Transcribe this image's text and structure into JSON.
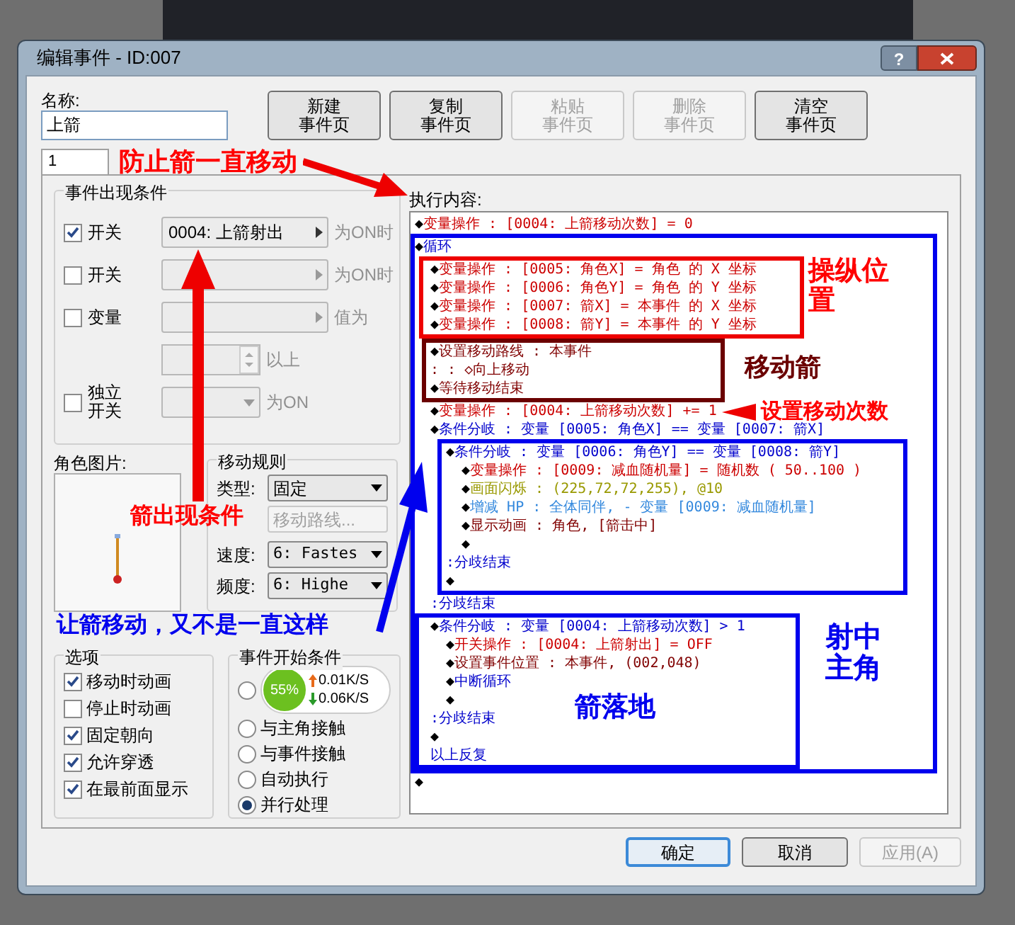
{
  "window": {
    "title": "编辑事件 - ID:007",
    "help_button": "?"
  },
  "name_field": {
    "label": "名称:",
    "value": "上箭"
  },
  "page_buttons": [
    {
      "lines": [
        "新建",
        "事件页"
      ],
      "disabled": false
    },
    {
      "lines": [
        "复制",
        "事件页"
      ],
      "disabled": false
    },
    {
      "lines": [
        "粘贴",
        "事件页"
      ],
      "disabled": true
    },
    {
      "lines": [
        "删除",
        "事件页"
      ],
      "disabled": true
    },
    {
      "lines": [
        "清空",
        "事件页"
      ],
      "disabled": false
    }
  ],
  "tabs": [
    {
      "label": "1",
      "selected": true
    }
  ],
  "conditions": {
    "title": "事件出现条件",
    "rows": [
      {
        "kind": "select",
        "label": "开关",
        "checked": true,
        "value": "0004: 上箭射出",
        "suffix": "为ON时"
      },
      {
        "kind": "select",
        "label": "开关",
        "checked": false,
        "suffix": "为ON时"
      },
      {
        "kind": "select",
        "label": "变量",
        "checked": false,
        "suffix": "值为"
      },
      {
        "kind": "spinner",
        "suffix": "以上"
      },
      {
        "kind": "dropdown",
        "label": "独立开关",
        "checked": false,
        "suffix": "为ON"
      }
    ]
  },
  "graphic": {
    "label": "角色图片:"
  },
  "movement": {
    "title": "移动规则",
    "type_label": "类型:",
    "type_value": "固定",
    "route_button": {
      "label": "移动路线...",
      "disabled": true
    },
    "speed_label": "速度:",
    "speed_value": "6: Fastes",
    "freq_label": "频度:",
    "freq_value": "6: Highe"
  },
  "options": {
    "title": "选项",
    "items": [
      {
        "label": "移动时动画",
        "checked": true
      },
      {
        "label": "停止时动画",
        "checked": false
      },
      {
        "label": "固定朝向",
        "checked": true
      },
      {
        "label": "允许穿透",
        "checked": true
      },
      {
        "label": "在最前面显示",
        "checked": true
      }
    ]
  },
  "trigger": {
    "title": "事件开始条件",
    "items": [
      {
        "selected": false
      },
      {
        "label": "与主角接触",
        "selected": false
      },
      {
        "label": "与事件接触",
        "selected": false
      },
      {
        "label": "自动执行",
        "selected": false
      },
      {
        "label": "并行处理",
        "selected": true
      }
    ]
  },
  "contents": {
    "title": "执行内容:",
    "lines": [
      {
        "bullet": "◆",
        "text": "变量操作 : [0004: 上箭移动次数] = 0",
        "color": "#cc0000"
      },
      {
        "bullet": "◆",
        "text": "循环",
        "color": "#0000cc",
        "children": [
          {
            "bullet": "◆",
            "text": "变量操作 : [0005: 角色X] = 角色 的 X 坐标",
            "color": "#cc0000"
          },
          {
            "bullet": "◆",
            "text": "变量操作 : [0006: 角色Y] = 角色 的 Y 坐标",
            "color": "#cc0000"
          },
          {
            "bullet": "◆",
            "text": "变量操作 : [0007: 箭X] = 本事件 的 X 坐标",
            "color": "#cc0000"
          },
          {
            "bullet": "◆",
            "text": "变量操作 : [0008: 箭Y] = 本事件 的 Y 坐标",
            "color": "#cc0000"
          },
          {
            "bullet": "◆",
            "text": "设置移动路线 : 本事件",
            "color": "#800000"
          },
          {
            "text": ":             : ◇向上移动",
            "color": "#800000"
          },
          {
            "bullet": "◆",
            "text": "等待移动结束",
            "color": "#800000"
          },
          {
            "bullet": "◆",
            "text": "变量操作 : [0004: 上箭移动次数] += 1",
            "color": "#cc0000"
          },
          {
            "bullet": "◆",
            "text": "条件分岐 : 变量 [0005: 角色X] == 变量 [0007: 箭X]",
            "color": "#0000cc",
            "children": [
              {
                "bullet": "◆",
                "text": "条件分岐 : 变量 [0006: 角色Y] == 变量 [0008: 箭Y]",
                "color": "#0000cc",
                "children": [
                  {
                    "bullet": "◆",
                    "text": "变量操作 : [0009: 减血随机量] = 随机数 ( 50..100 )",
                    "color": "#cc0000"
                  },
                  {
                    "bullet": "◆",
                    "text": "画面闪烁 : (225,72,72,255), @10",
                    "color": "#999900"
                  },
                  {
                    "bullet": "◆",
                    "text": "增减 HP : 全体同伴, - 变量 [0009: 减血随机量]",
                    "color": "#3388dd"
                  },
                  {
                    "bullet": "◆",
                    "text": "显示动画 : 角色, [箭击中]",
                    "color": "#800000"
                  },
                  {
                    "bullet": "◆"
                  }
                ]
              },
              {
                "text": ":分歧结束",
                "color": "#0000cc"
              },
              {
                "bullet": "◆"
              }
            ]
          },
          {
            "text": ":分歧结束",
            "color": "#0000cc"
          },
          {
            "bullet": "◆",
            "text": "条件分岐 : 变量 [0004: 上箭移动次数] > 1",
            "color": "#0000cc",
            "children": [
              {
                "bullet": "◆",
                "text": "开关操作 : [0004: 上箭射出] = OFF",
                "color": "#cc0000"
              },
              {
                "bullet": "◆",
                "text": "设置事件位置 : 本事件, (002,048)",
                "color": "#800000"
              },
              {
                "bullet": "◆",
                "text": "中断循环",
                "color": "#0000cc"
              },
              {
                "bullet": "◆"
              }
            ]
          },
          {
            "text": ":分歧结束",
            "color": "#0000cc"
          },
          {
            "bullet": "◆"
          },
          {
            "text": "以上反复",
            "color": "#0000cc"
          }
        ]
      },
      {
        "bullet": "◆"
      }
    ]
  },
  "footer_buttons": [
    {
      "label": "确定",
      "kind": "default"
    },
    {
      "label": "取消",
      "kind": "normal"
    },
    {
      "label": "应用(A)",
      "kind": "disabled"
    }
  ],
  "annotations": [
    {
      "text": "防止箭一直移动",
      "color": "#ff0000"
    },
    {
      "text": "箭出现条件",
      "color": "#ff0000"
    },
    {
      "text": "操纵位置",
      "color": "#ff0000"
    },
    {
      "text": "移动箭",
      "color": "#6b0000"
    },
    {
      "text": "设置移动次数",
      "color": "#ff0000"
    },
    {
      "text": "射中主角",
      "color": "#0000ee"
    },
    {
      "text": "让箭移动，又不是一直这样",
      "color": "#0000ee"
    },
    {
      "text": "箭落地",
      "color": "#0000ee"
    }
  ],
  "net_widget": {
    "percent": "55%",
    "upload": "0.01K/S",
    "download": "0.06K/S"
  }
}
